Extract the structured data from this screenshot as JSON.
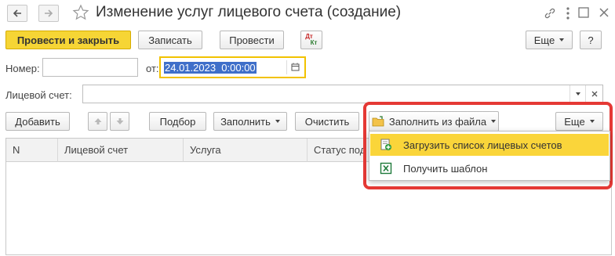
{
  "window": {
    "title": "Изменение услуг лицевого счета (создание)"
  },
  "toolbar": {
    "post_and_close": "Провести и закрыть",
    "save": "Записать",
    "post": "Провести",
    "dt_kt_top": "Дт",
    "dt_kt_bottom": "Кт",
    "more": "Еще",
    "help": "?"
  },
  "form": {
    "number_label": "Номер:",
    "number_value": "",
    "date_label": "от:",
    "date_value": "24.01.2023  0:00:00",
    "account_label": "Лицевой счет:",
    "account_value": ""
  },
  "table_toolbar": {
    "add": "Добавить",
    "select": "Подбор",
    "fill": "Заполнить",
    "clear": "Очистить",
    "fill_from_file": "Заполнить из файла",
    "more": "Еще"
  },
  "table": {
    "columns": [
      "N",
      "Лицевой счет",
      "Услуга",
      "Статус под"
    ]
  },
  "dropdown": {
    "items": [
      {
        "label": "Загрузить список лицевых счетов",
        "icon": "load-accounts-icon"
      },
      {
        "label": "Получить шаблон",
        "icon": "excel-icon"
      }
    ]
  },
  "colors": {
    "primary_button": "#f6d535",
    "highlight_border": "#e53935",
    "active_menu_item": "#fad53a"
  }
}
